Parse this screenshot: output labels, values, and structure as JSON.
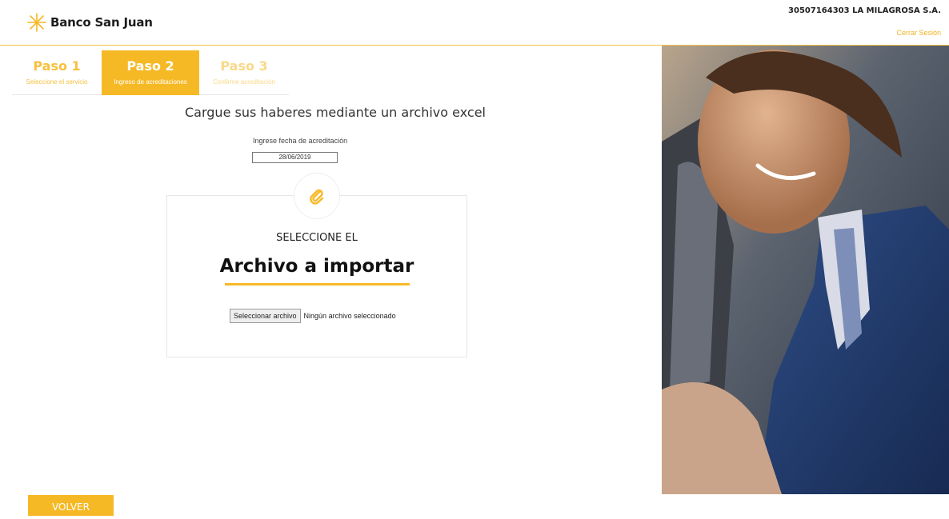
{
  "header": {
    "brand": "Banco San Juan",
    "company": "30507164303 LA MILAGROSA S.A.",
    "logout": "Cerrar Sesión",
    "colors": {
      "accent": "#f6b926",
      "link": "#f0b323"
    }
  },
  "steps": [
    {
      "title": "Paso 1",
      "subtitle": "Seleccione el servicio",
      "state": "done"
    },
    {
      "title": "Paso 2",
      "subtitle": "Ingreso de acreditaciones",
      "state": "active"
    },
    {
      "title": "Paso 3",
      "subtitle": "Confirme acreditación",
      "state": "pending"
    }
  ],
  "main": {
    "title": "Cargue sus haberes mediante un archivo excel",
    "date_label": "Ingrese fecha de acreditación",
    "date_value": "28/06/2019",
    "upload": {
      "icon": "paperclip-icon",
      "select_label": "SELECCIONE EL",
      "heading": "Archivo a importar",
      "button": "Seleccionar archivo",
      "status": "Ningún archivo seleccionado"
    }
  },
  "footer": {
    "back": "VOLVER"
  }
}
